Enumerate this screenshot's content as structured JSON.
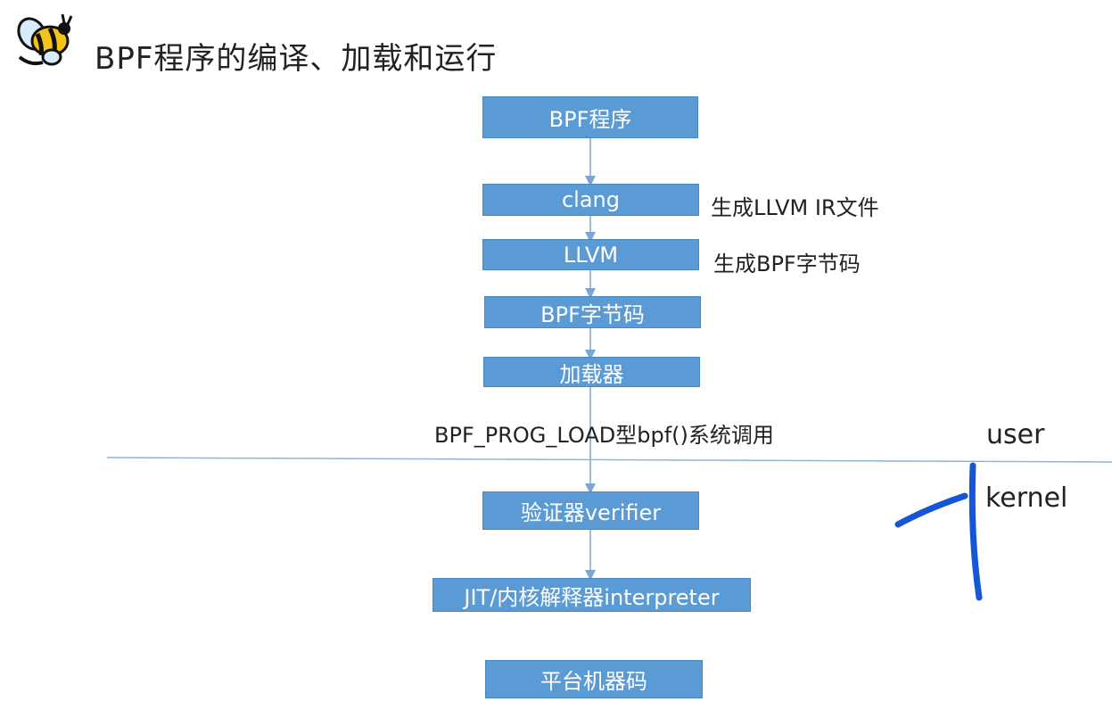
{
  "title": "BPF程序的编译、加载和运行",
  "boxes": {
    "bpf_program": "BPF程序",
    "clang": "clang",
    "llvm": "LLVM",
    "bytecode": "BPF字节码",
    "loader": "加载器",
    "verifier": "验证器verifier",
    "jit": "JIT/内核解释器interpreter",
    "machine_code": "平台机器码"
  },
  "notes": {
    "clang_note": "生成LLVM IR文件",
    "llvm_note": "生成BPF字节码",
    "syscall": "BPF_PROG_LOAD型bpf()系统调用"
  },
  "regions": {
    "user": "user",
    "kernel": "kernel"
  },
  "colors": {
    "box_fill": "#5b9bd5",
    "connector": "#7aa6d6",
    "boundary": "#8fb3db",
    "annotation": "#1456d6"
  }
}
